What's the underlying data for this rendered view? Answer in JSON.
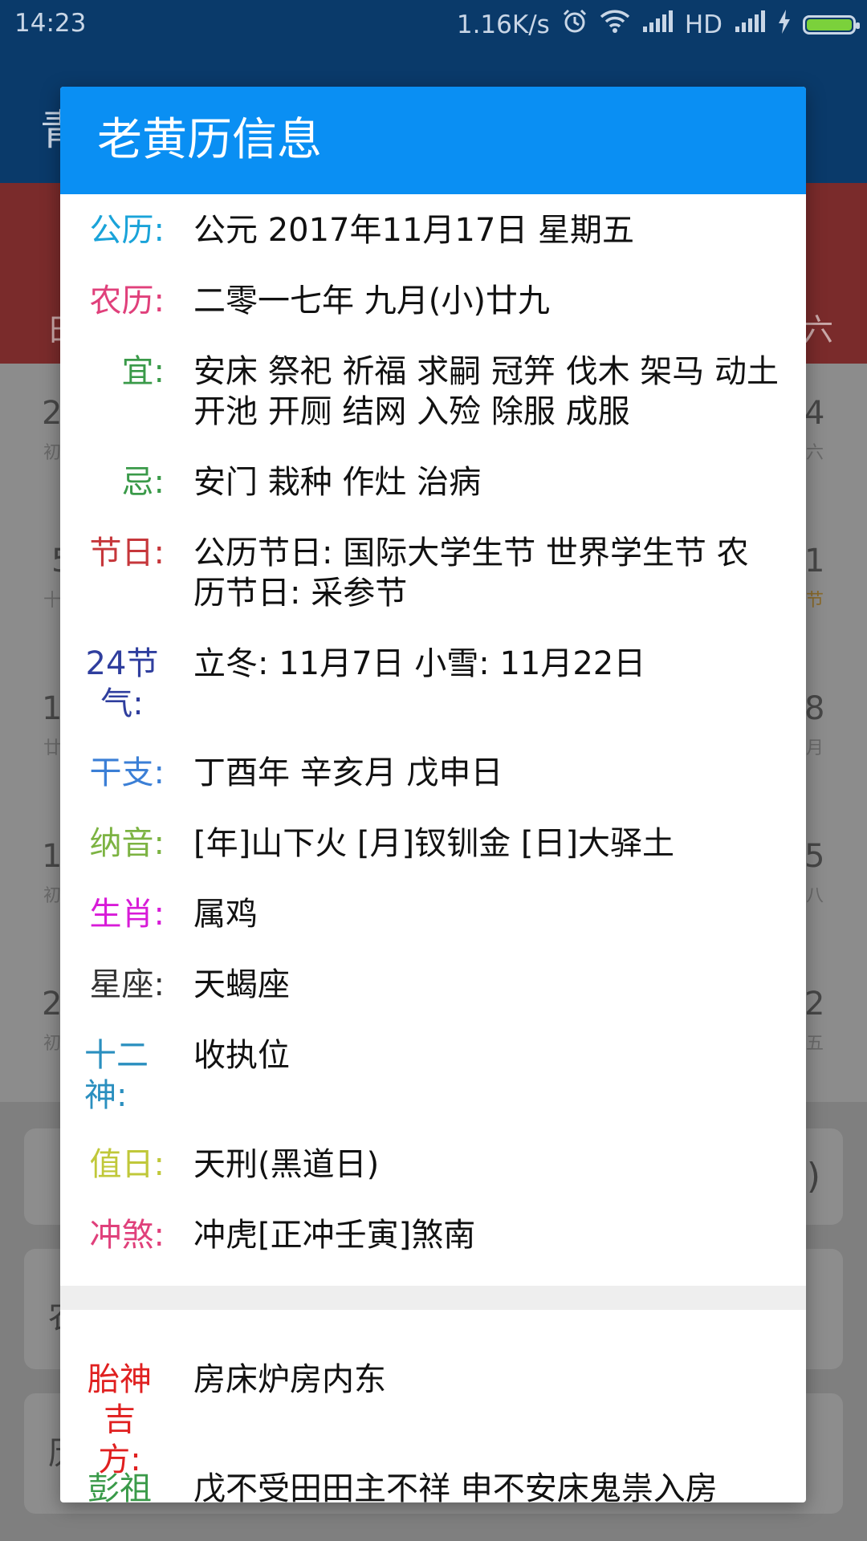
{
  "status_bar": {
    "time": "14:23",
    "network_speed": "1.16K/s",
    "hd": "HD",
    "battery_color": "#7bd13b"
  },
  "dialog": {
    "title": "老黄历信息",
    "header_color": "#0a8ff3",
    "rows": [
      {
        "label": "公历:",
        "value": "公元 2017年11月17日 星期五",
        "color": "#1aa3d9"
      },
      {
        "label": "农历:",
        "value": "二零一七年 九月(小)廿九",
        "color": "#e0407b"
      },
      {
        "label": "宜:",
        "value": "安床 祭祀 祈福 求嗣 冠笄 伐木 架马 动土 开池 开厕 结网 入殓 除服 成服",
        "color": "#3a9a49"
      },
      {
        "label": "忌:",
        "value": "安门 栽种 作灶 治病",
        "color": "#3a9a49"
      },
      {
        "label": "节日:",
        "value": "公历节日: 国际大学生节 世界学生节 农历节日: 采参节",
        "color": "#c6373b"
      },
      {
        "label": "24节气:",
        "value": "立冬: 11月7日 小雪: 11月22日",
        "color": "#2f3e9e"
      },
      {
        "label": "干支:",
        "value": "丁酉年 辛亥月 戊申日",
        "color": "#3b7fd6"
      },
      {
        "label": "纳音:",
        "value": "[年]山下火 [月]钗钏金 [日]大驿土",
        "color": "#7cb342"
      },
      {
        "label": "生肖:",
        "value": "属鸡",
        "color": "#d81bd8"
      },
      {
        "label": "星座:",
        "value": "天蝎座",
        "color": "#333333"
      },
      {
        "label": "十二神:",
        "value": "收执位",
        "color": "#2a8fbf"
      },
      {
        "label": "值日:",
        "value": "天刑(黑道日)",
        "color": "#c0c83a"
      },
      {
        "label": "冲煞:",
        "value": "冲虎[正冲壬寅]煞南",
        "color": "#e0407b"
      },
      {
        "label": "胎神吉方:",
        "value": "房床炉房内东",
        "color": "#e02020"
      },
      {
        "label": "彭祖百忌:",
        "value": "戊不受田田主不祥 申不安床鬼祟入房",
        "color": "#3a9a49"
      }
    ]
  },
  "background": {
    "app_title_partial": "青",
    "weekday_left": "日",
    "weekday_right": "六",
    "calendar_left": [
      {
        "num": "2",
        "sub": "初"
      },
      {
        "num": "5",
        "sub": "十"
      },
      {
        "num": "1",
        "sub": "廿"
      },
      {
        "num": "1",
        "sub": "初"
      },
      {
        "num": "2",
        "sub": "初"
      }
    ],
    "calendar_right": [
      {
        "num": "4",
        "sub": "六"
      },
      {
        "num": "1",
        "sub": "节"
      },
      {
        "num": "8",
        "sub": "月"
      },
      {
        "num": "5",
        "sub": "八"
      },
      {
        "num": "2",
        "sub": "五"
      }
    ],
    "card_right_glyph": ")",
    "card_left_1": "农",
    "card_left_2": "历"
  }
}
